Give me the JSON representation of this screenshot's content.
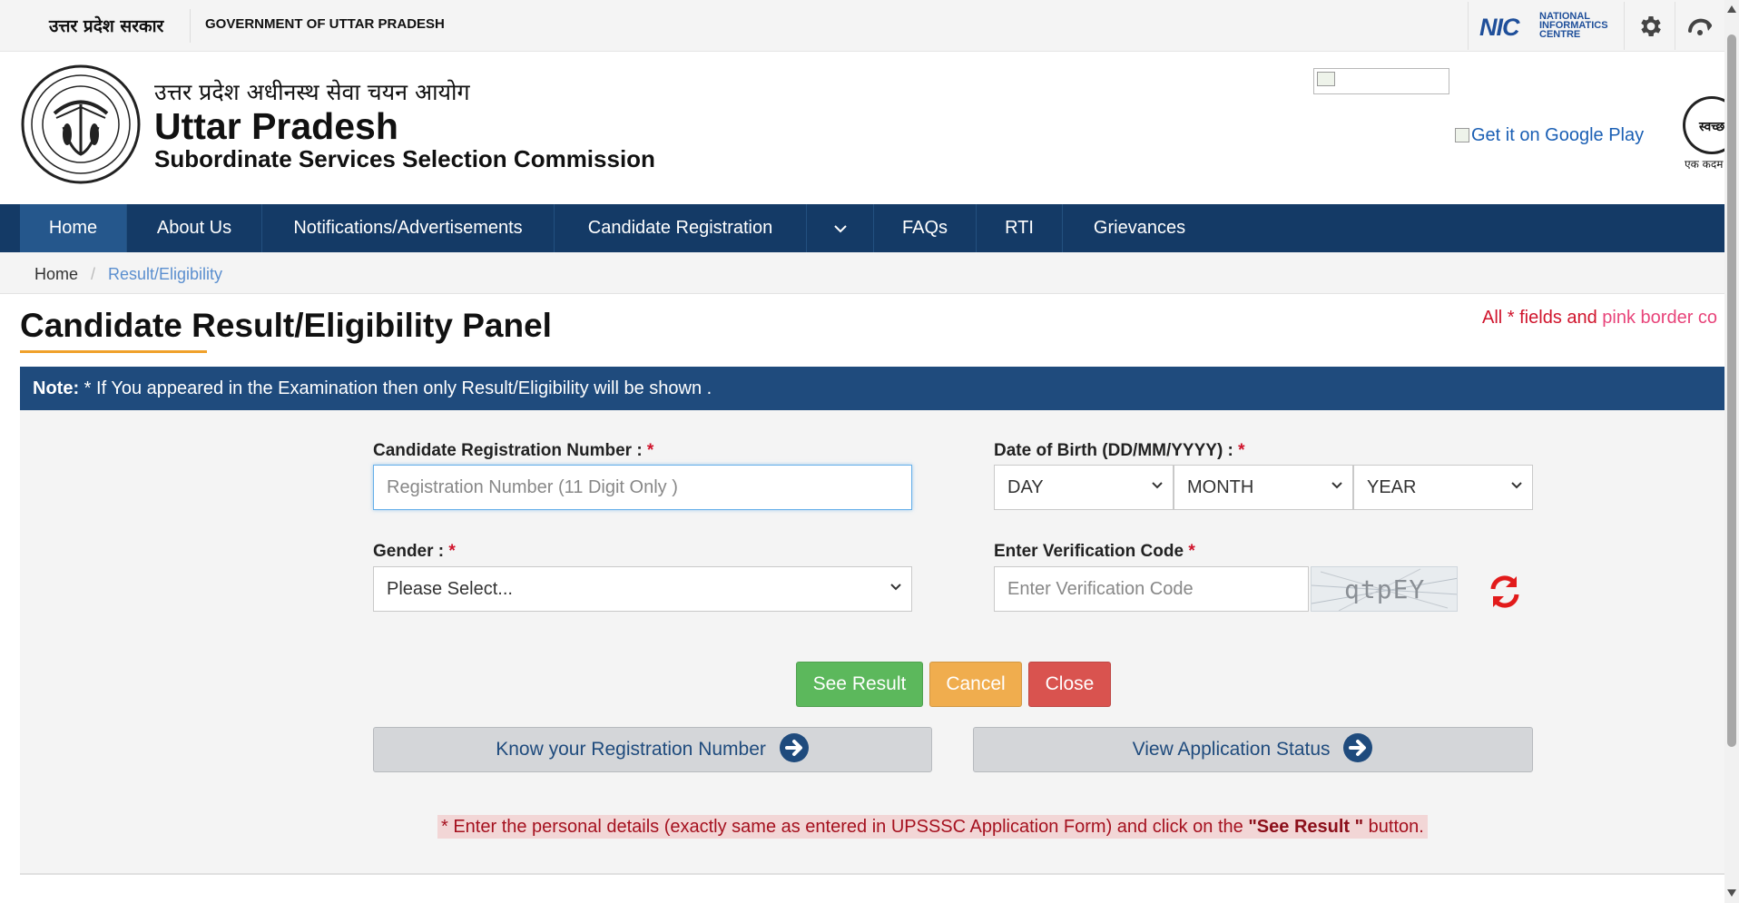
{
  "topbar": {
    "hindi_title": "उत्तर प्रदेश सरकार",
    "english_title": "GOVERNMENT OF UTTAR PRADESH",
    "nic_logo": "NIC",
    "nic_text_1": "NATIONAL",
    "nic_text_2": "INFORMATICS",
    "nic_text_3": "CENTRE",
    "icons": [
      "gear-icon",
      "accessibility-icon"
    ]
  },
  "header": {
    "org_hindi": "उत्तर प्रदेश अधीनस्थ सेवा चयन आयोग",
    "org_main": "Uttar Pradesh",
    "org_sub": "Subordinate Services Selection Commission",
    "google_play_alt": "Get it on Google Play",
    "swachh_text_1": "स्वच्छ",
    "swachh_text_2": "एक कदम"
  },
  "nav": {
    "items": [
      {
        "label": "Home"
      },
      {
        "label": "About Us"
      },
      {
        "label": "Notifications/Advertisements"
      },
      {
        "label": "Candidate Registration"
      },
      {
        "label": ""
      },
      {
        "label": "FAQs"
      },
      {
        "label": "RTI"
      },
      {
        "label": "Grievances"
      }
    ]
  },
  "breadcrumb": {
    "home": "Home",
    "separator": "/",
    "current": "Result/Eligibility"
  },
  "page": {
    "title": "Candidate Result/Eligibility Panel",
    "required_note_part1": "All * fields and ",
    "required_note_part2": "pink border co"
  },
  "note": {
    "prefix": "Note:",
    "text": " * If You appeared in the Examination then only Result/Eligibility will be shown ."
  },
  "form": {
    "reg_label": "Candidate Registration Number : ",
    "reg_placeholder": "Registration Number (11 Digit Only )",
    "reg_value": "",
    "dob_label": "Date of Birth (DD/MM/YYYY) : ",
    "dob_day": "DAY",
    "dob_month": "MONTH",
    "dob_year": "YEAR",
    "gender_label": "Gender : ",
    "gender_value": "Please Select...",
    "captcha_label": "Enter Verification Code ",
    "captcha_placeholder": "Enter Verification Code",
    "captcha_text": "qtpEY",
    "required_mark": "*"
  },
  "buttons": {
    "see_result": "See Result",
    "cancel": "Cancel",
    "close": "Close",
    "know_reg": "Know your Registration Number",
    "view_status": "View Application Status"
  },
  "footnote": {
    "part1": "* Enter the personal details (exactly same as entered in UPSSSC Application Form) and click on the ",
    "bold": "\"See Result \"",
    "part2": " button."
  },
  "colors": {
    "nav_bg": "#143a66",
    "note_bg": "#1f4b7d",
    "required_red": "#d0142c",
    "btn_green": "#5cb85c",
    "btn_orange": "#f0ad4e",
    "btn_red": "#d9534f"
  }
}
